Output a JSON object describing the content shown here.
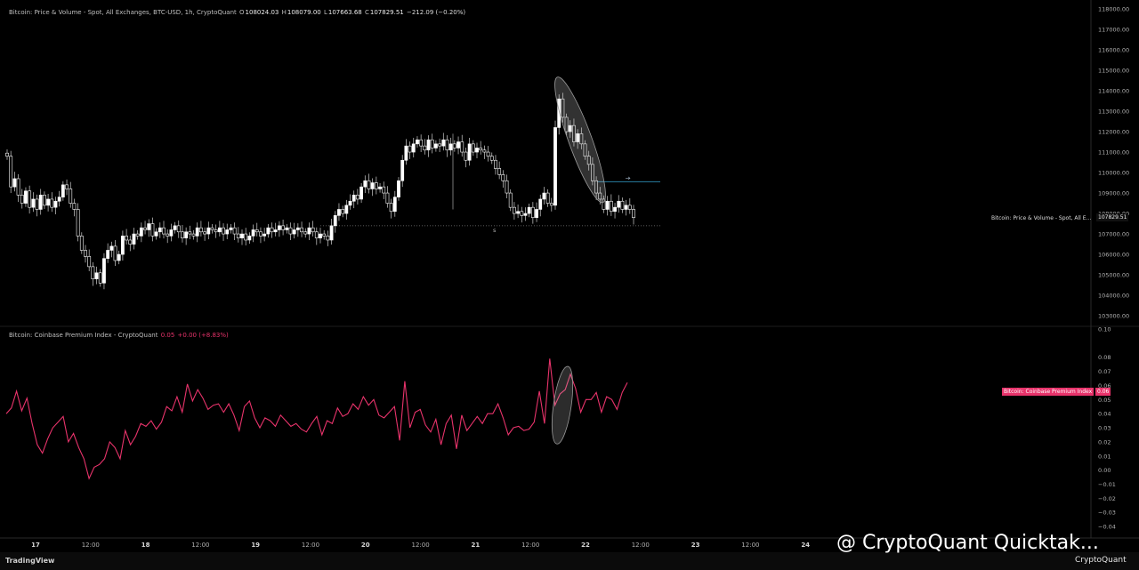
{
  "legend_price": {
    "title": "Bitcoin: Price & Volume - Spot, All Exchanges, BTC-USD, 1h, CryptoQuant",
    "o_label": "O",
    "o": "108024.03",
    "h_label": "H",
    "h": "108079.00",
    "l_label": "L",
    "l": "107663.68",
    "c_label": "C",
    "c": "107829.51",
    "change": "−212.09 (−0.20%)"
  },
  "legend_premium": {
    "title": "Bitcoin: Coinbase Premium Index - CryptoQuant",
    "value": "0.05",
    "change": "+0.00 (+8.83%)"
  },
  "price_tag": {
    "series": "Bitcoin: Price & Volume - Spot, All E...",
    "value": "107829.51"
  },
  "premium_tag": {
    "series": "Bitcoin: Coinbase Premium Index",
    "value": "0.06"
  },
  "footer": {
    "brand": "TradingView",
    "watermark": "@ CryptoQuant Quicktak...",
    "logo": "CryptoQuant"
  },
  "colors": {
    "background": "#000000",
    "up": "#ffffff",
    "down": "#ffffff",
    "premium_line": "#e8336b",
    "hline": "#2a7fa3"
  },
  "chart_data": [
    {
      "type": "candlestick",
      "yticks": [
        "118000.00",
        "117000.00",
        "116000.00",
        "115000.00",
        "114000.00",
        "113000.00",
        "112000.00",
        "111000.00",
        "110000.00",
        "109000.00",
        "108000.00",
        "107000.00",
        "106000.00",
        "105000.00",
        "104000.00",
        "103000.00"
      ],
      "ylim": [
        102700,
        118000
      ],
      "xtick_labels": [
        "17",
        "12:00",
        "18",
        "12:00",
        "19",
        "12:00",
        "20",
        "12:00",
        "21",
        "12:00",
        "22",
        "12:00",
        "23",
        "12:00",
        "24"
      ],
      "hline_value": 109550,
      "dotted_value": 107400,
      "series_close": [
        110800,
        109300,
        109700,
        108900,
        108500,
        109100,
        108300,
        108700,
        108200,
        108900,
        108400,
        108700,
        108300,
        108600,
        108800,
        109400,
        109200,
        108500,
        108200,
        106900,
        106200,
        105900,
        105400,
        104800,
        105100,
        104600,
        105800,
        106200,
        106400,
        105700,
        106000,
        106900,
        106700,
        106500,
        107000,
        106900,
        107300,
        107200,
        107500,
        106900,
        107100,
        107300,
        107000,
        106900,
        107200,
        107400,
        107100,
        106800,
        107100,
        107000,
        106900,
        107300,
        107100,
        107000,
        107300,
        107200,
        107100,
        107300,
        107000,
        107200,
        107300,
        107000,
        106800,
        107000,
        106700,
        106900,
        107200,
        107100,
        106900,
        107000,
        107300,
        107100,
        107200,
        107400,
        107200,
        107300,
        107000,
        107200,
        107300,
        107100,
        107000,
        107300,
        107100,
        106800,
        107000,
        106900,
        106700,
        107400,
        107900,
        108200,
        108000,
        108400,
        108600,
        108900,
        108700,
        109300,
        109600,
        109200,
        109500,
        109200,
        109300,
        109000,
        108500,
        108100,
        108800,
        109600,
        110600,
        111300,
        111000,
        111400,
        111600,
        111300,
        111100,
        111600,
        111200,
        111400,
        111300,
        111600,
        111100,
        111400,
        111200,
        111500,
        111000,
        110600,
        111400,
        111000,
        111200,
        111100,
        111000,
        110800,
        110600,
        110200,
        109900,
        109600,
        109000,
        108300,
        108000,
        108100,
        107900,
        108000,
        108300,
        107800,
        108200,
        108700,
        109000,
        108500,
        108400,
        112200,
        113600,
        112700,
        112000,
        112300,
        111500,
        111900,
        111400,
        110800,
        110400,
        109600,
        109000,
        108700,
        108200,
        108600,
        108100,
        108300,
        108600,
        108200,
        108400,
        108200,
        107800
      ],
      "anchor_closes": {
        "first": 110800,
        "last": 107829.51
      }
    },
    {
      "type": "line",
      "yticks": [
        "0.10",
        "0.08",
        "0.07",
        "0.06",
        "0.05",
        "0.04",
        "0.03",
        "0.02",
        "0.01",
        "0.00",
        "−0.01",
        "−0.02",
        "−0.03",
        "−0.04"
      ],
      "ylim": [
        -0.045,
        0.1
      ],
      "series": [
        {
          "values": [
            0.04,
            0.044,
            0.056,
            0.042,
            0.051,
            0.033,
            0.018,
            0.012,
            0.022,
            0.03,
            0.034,
            0.038,
            0.02,
            0.026,
            0.016,
            0.008,
            -0.006,
            0.002,
            0.004,
            0.008,
            0.02,
            0.016,
            0.008,
            0.028,
            0.018,
            0.024,
            0.033,
            0.031,
            0.035,
            0.029,
            0.034,
            0.045,
            0.042,
            0.052,
            0.041,
            0.061,
            0.049,
            0.057,
            0.051,
            0.043,
            0.046,
            0.047,
            0.041,
            0.047,
            0.039,
            0.028,
            0.045,
            0.049,
            0.037,
            0.03,
            0.037,
            0.035,
            0.031,
            0.039,
            0.035,
            0.031,
            0.033,
            0.029,
            0.027,
            0.033,
            0.038,
            0.025,
            0.035,
            0.033,
            0.044,
            0.038,
            0.04,
            0.047,
            0.043,
            0.052,
            0.046,
            0.05,
            0.039,
            0.037,
            0.041,
            0.045,
            0.021,
            0.063,
            0.03,
            0.041,
            0.043,
            0.032,
            0.027,
            0.036,
            0.018,
            0.033,
            0.039,
            0.015,
            0.039,
            0.028,
            0.033,
            0.038,
            0.033,
            0.04,
            0.04,
            0.047,
            0.037,
            0.025,
            0.03,
            0.031,
            0.028,
            0.029,
            0.034,
            0.056,
            0.033,
            0.079,
            0.046,
            0.054,
            0.057,
            0.068,
            0.058,
            0.041,
            0.05,
            0.05,
            0.055,
            0.041,
            0.052,
            0.05,
            0.043,
            0.055,
            0.062
          ]
        }
      ]
    }
  ]
}
